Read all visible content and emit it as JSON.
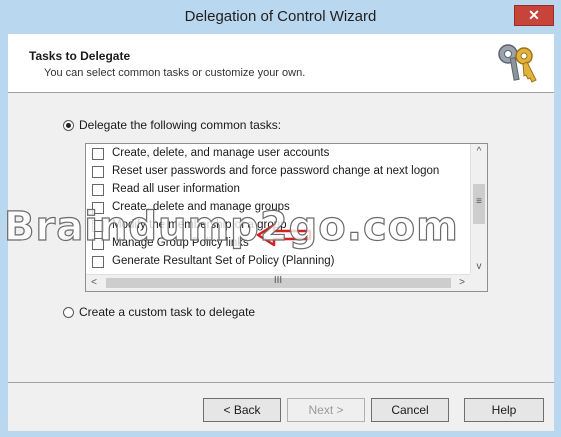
{
  "window": {
    "title": "Delegation of Control Wizard",
    "close_glyph": "✕"
  },
  "header": {
    "title": "Tasks to Delegate",
    "subtitle": "You can select common tasks or customize your own.",
    "icon": "key-icon"
  },
  "options": {
    "common": {
      "label": "Delegate the following common tasks:",
      "selected": true
    },
    "custom": {
      "label": "Create a custom task to delegate",
      "selected": false
    }
  },
  "tasks": [
    {
      "label": "Create, delete, and manage user accounts",
      "checked": false
    },
    {
      "label": "Reset user passwords and force password change at next logon",
      "checked": false
    },
    {
      "label": "Read all user information",
      "checked": false
    },
    {
      "label": "Create, delete and manage groups",
      "checked": false
    },
    {
      "label": "Modify the membership of a group",
      "checked": false
    },
    {
      "label": "Manage Group Policy links",
      "checked": false
    },
    {
      "label": "Generate Resultant Set of Policy (Planning)",
      "checked": false
    }
  ],
  "scrollbar": {
    "up": "^",
    "down": "v",
    "left": "<",
    "right": ">",
    "grip": "≡",
    "hgrip": "III"
  },
  "buttons": {
    "back": "< Back",
    "next": "Next >",
    "cancel": "Cancel",
    "help": "Help"
  },
  "watermark": "Braindump2go.com",
  "colors": {
    "title_bar": "#b9d7ef",
    "close": "#c7443a",
    "annotation_arrow": "#d42020"
  }
}
